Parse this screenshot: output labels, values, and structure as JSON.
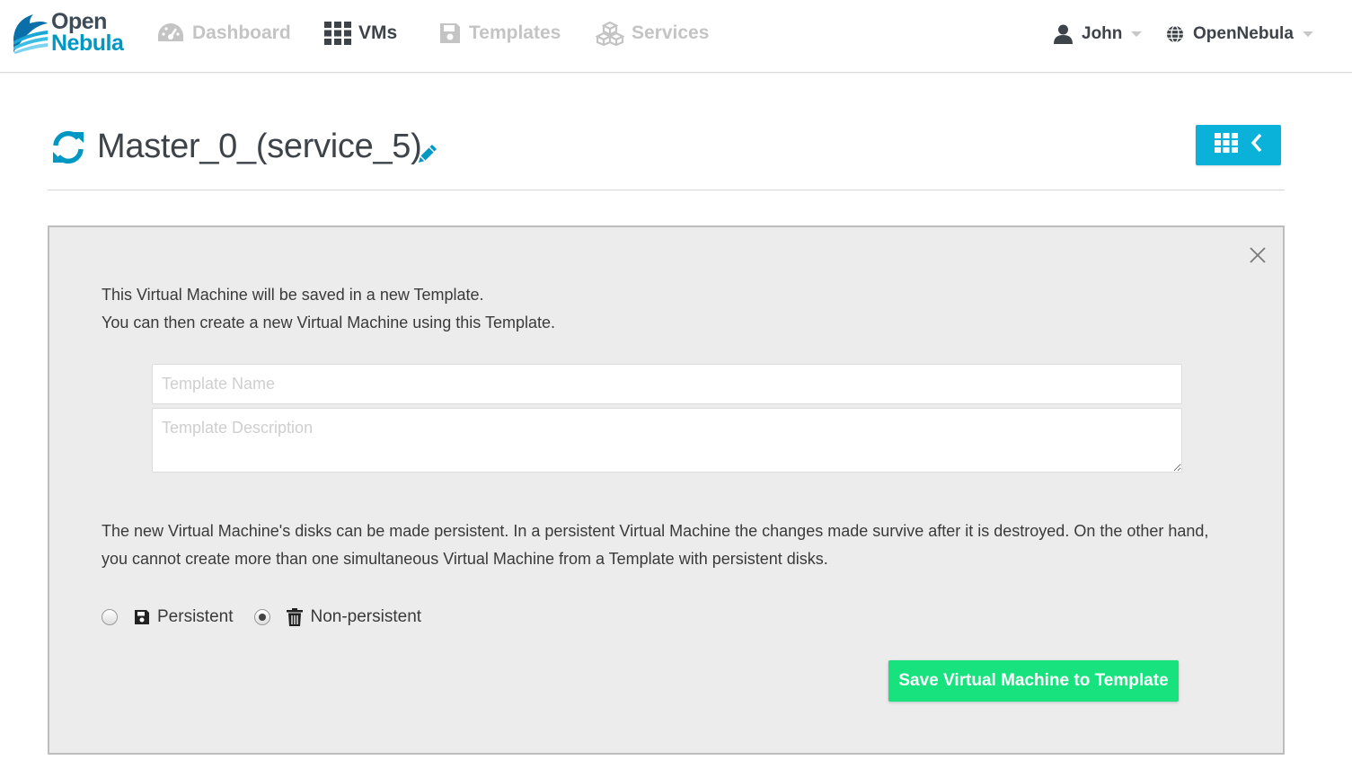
{
  "brand": {
    "line1": "Open",
    "line2": "Nebula",
    "accent": "#0098c3"
  },
  "nav": {
    "dashboard": {
      "label": "Dashboard",
      "icon": "dashboard-icon"
    },
    "vms": {
      "label": "VMs",
      "icon": "grid-icon",
      "active": true
    },
    "templates": {
      "label": "Templates",
      "icon": "save-icon"
    },
    "services": {
      "label": "Services",
      "icon": "cubes-icon"
    }
  },
  "user_menu": {
    "label": "John",
    "icon": "user-icon"
  },
  "zone_menu": {
    "label": "OpenNebula",
    "icon": "globe-icon"
  },
  "page": {
    "title": "Master_0_(service_5)",
    "title_icon": "refresh-icon",
    "edit_icon": "pencil-icon",
    "back_button_icons": [
      "grid-icon",
      "chevron-left-icon"
    ],
    "back_button_color": "#0ab1d8"
  },
  "dialog": {
    "intro_line1": "This Virtual Machine will be saved in a new Template.",
    "intro_line2": "You can then create a new Virtual Machine using this Template.",
    "template_name_placeholder": "Template Name",
    "template_name_value": "",
    "template_description_placeholder": "Template Description",
    "template_description_value": "",
    "persistence_text": "The new Virtual Machine's disks can be made persistent. In a persistent Virtual Machine the changes made survive after it is destroyed. On the other hand, you cannot create more than one simultaneous Virtual Machine from a Template with persistent disks.",
    "options": [
      {
        "label": "Persistent",
        "icon": "save-icon",
        "checked": false
      },
      {
        "label": "Non-persistent",
        "icon": "trash-icon",
        "checked": true
      }
    ],
    "save_button": "Save Virtual Machine to Template",
    "save_button_color": "#17e27e"
  }
}
